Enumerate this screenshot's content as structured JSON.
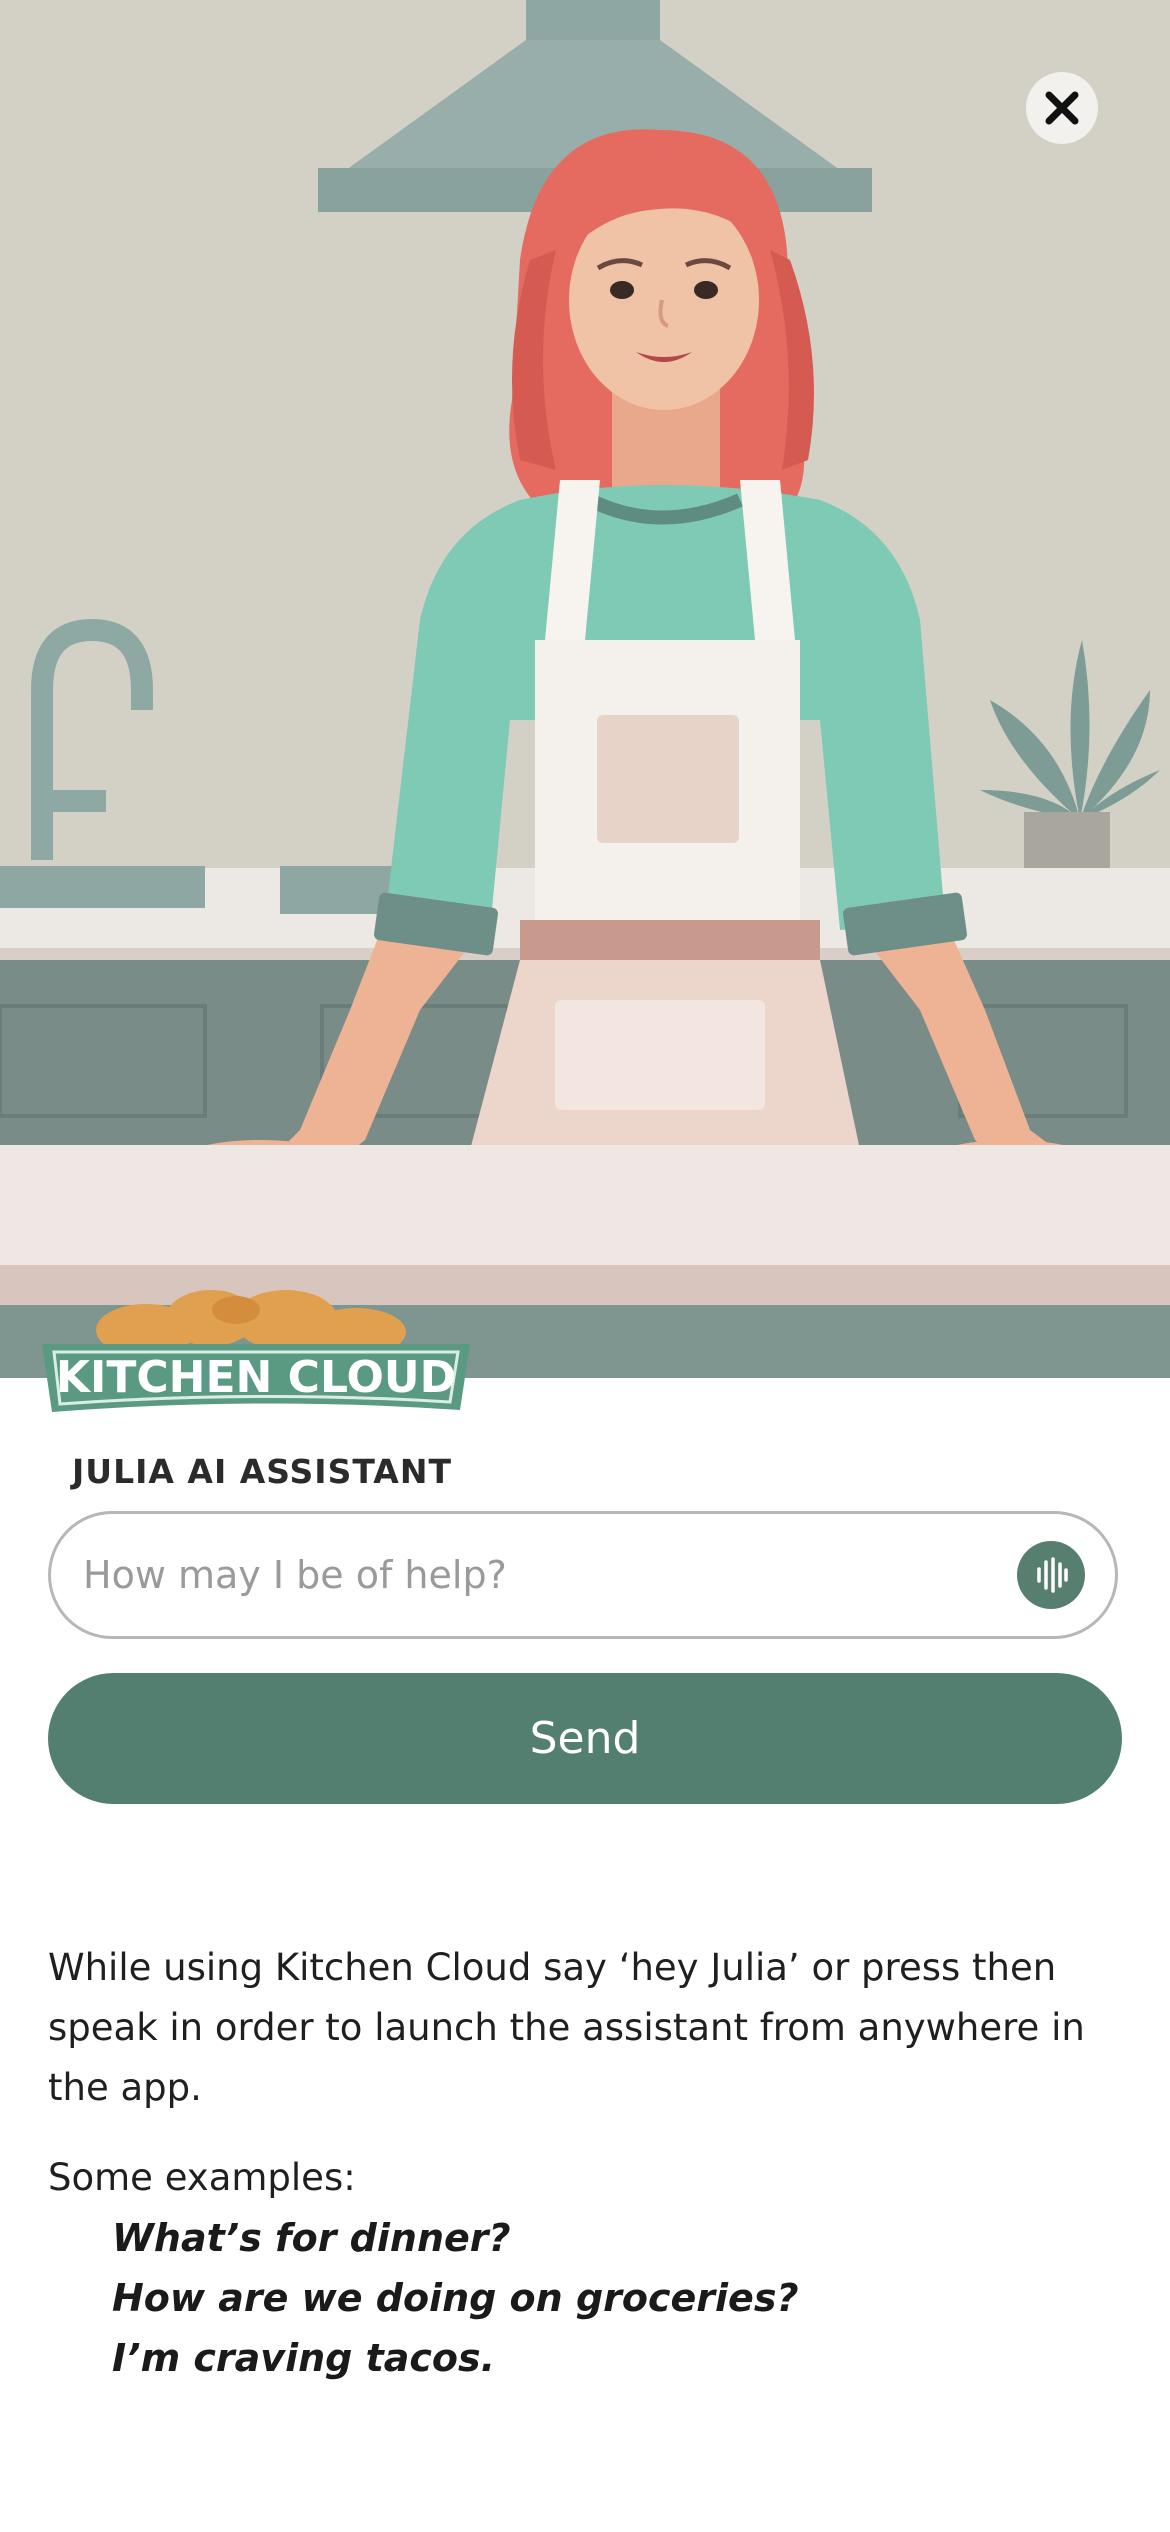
{
  "header": {
    "close_icon": "close-icon"
  },
  "brand": {
    "logo_text": "KITCHEN CLOUD",
    "assistant_label": "JULIA AI ASSISTANT"
  },
  "search": {
    "placeholder": "How may I be of help?",
    "value": "",
    "mic_icon": "voice-waveform-icon"
  },
  "actions": {
    "send_label": "Send"
  },
  "info": {
    "instructions": "While using Kitchen Cloud say ‘hey Julia’ or press then speak in order to launch the assistant from anywhere in the app.",
    "examples_title": "Some examples:",
    "examples": [
      "What’s for dinner?",
      "How are we doing on groceries?",
      "I’m craving tacos."
    ]
  },
  "colors": {
    "brand_green": "#537f70",
    "logo_green": "#5a9a82",
    "hair": "#e56b61",
    "sweater": "#7ecab5",
    "wall": "#d3d0c6"
  }
}
